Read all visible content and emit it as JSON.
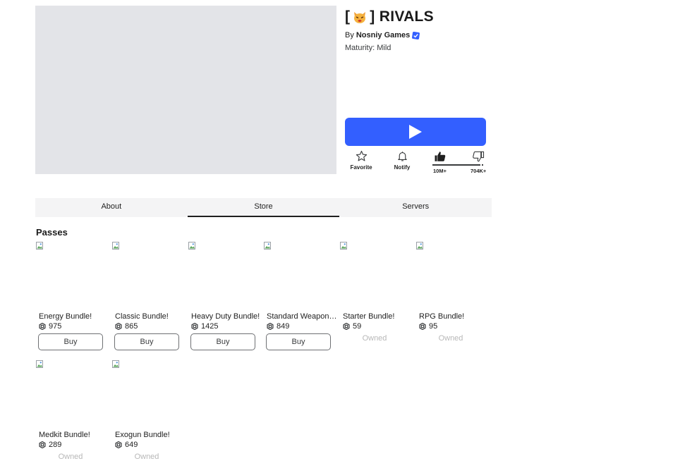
{
  "game": {
    "title_open": "[",
    "title_close": "] RIVALS",
    "by_label": "By",
    "creator": "Nosniy Games",
    "maturity": "Maturity: Mild"
  },
  "actions": {
    "favorite": "Favorite",
    "notify": "Notify",
    "upvotes": "10M+",
    "downvotes": "704K+",
    "upvote_fraction": 0.93
  },
  "tabs": [
    {
      "label": "About",
      "active": false
    },
    {
      "label": "Store",
      "active": true
    },
    {
      "label": "Servers",
      "active": false
    }
  ],
  "store": {
    "section_title": "Passes",
    "buy_label": "Buy",
    "owned_label": "Owned",
    "passes": [
      {
        "name": "Energy Bundle!",
        "price": "975",
        "owned": false
      },
      {
        "name": "Classic Bundle!",
        "price": "865",
        "owned": false
      },
      {
        "name": "Heavy Duty Bundle!",
        "price": "1425",
        "owned": false
      },
      {
        "name": "Standard Weapons Bundle!",
        "price": "849",
        "owned": false
      },
      {
        "name": "Starter Bundle!",
        "price": "59",
        "owned": true
      },
      {
        "name": "RPG Bundle!",
        "price": "95",
        "owned": true
      },
      {
        "name": "Medkit Bundle!",
        "price": "289",
        "owned": true
      },
      {
        "name": "Exogun Bundle!",
        "price": "649",
        "owned": true
      }
    ]
  },
  "colors": {
    "play_button": "#335fff",
    "verified_badge": "#335fff",
    "thumbnail_placeholder": "#e3e4e8"
  }
}
